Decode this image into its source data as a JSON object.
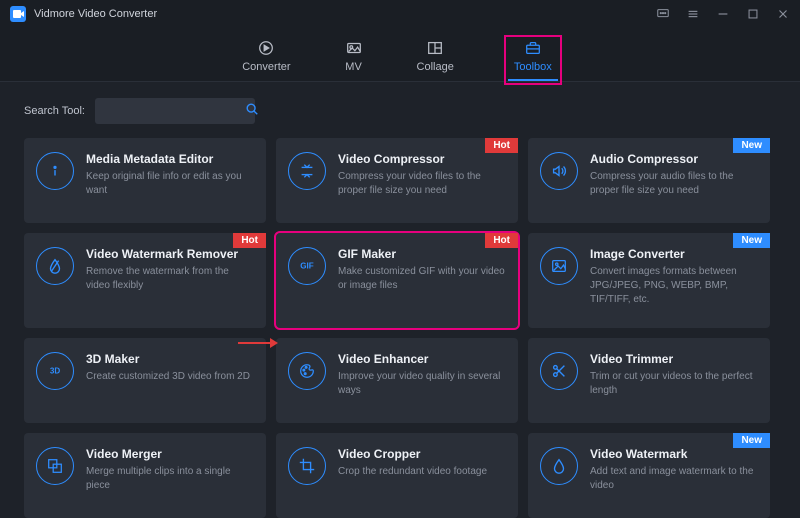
{
  "app": {
    "title": "Vidmore Video Converter"
  },
  "nav": {
    "tabs": [
      {
        "label": "Converter"
      },
      {
        "label": "MV"
      },
      {
        "label": "Collage"
      },
      {
        "label": "Toolbox"
      }
    ]
  },
  "search": {
    "label": "Search Tool:",
    "value": ""
  },
  "badges": {
    "hot": "Hot",
    "new": "New"
  },
  "tools": [
    {
      "icon": "info",
      "title": "Media Metadata Editor",
      "desc": "Keep original file info or edit as you want",
      "badge": ""
    },
    {
      "icon": "compress",
      "title": "Video Compressor",
      "desc": "Compress your video files to the proper file size you need",
      "badge": "hot"
    },
    {
      "icon": "audio-compress",
      "title": "Audio Compressor",
      "desc": "Compress your audio files to the proper file size you need",
      "badge": "new"
    },
    {
      "icon": "droplet",
      "title": "Video Watermark Remover",
      "desc": "Remove the watermark from the video flexibly",
      "badge": "hot"
    },
    {
      "icon": "gif",
      "title": "GIF Maker",
      "desc": "Make customized GIF with your video or image files",
      "badge": "hot"
    },
    {
      "icon": "image",
      "title": "Image Converter",
      "desc": "Convert images formats between JPG/JPEG, PNG, WEBP, BMP, TIF/TIFF, etc.",
      "badge": "new"
    },
    {
      "icon": "3d",
      "title": "3D Maker",
      "desc": "Create customized 3D video from 2D",
      "badge": ""
    },
    {
      "icon": "palette",
      "title": "Video Enhancer",
      "desc": "Improve your video quality in several ways",
      "badge": ""
    },
    {
      "icon": "scissors",
      "title": "Video Trimmer",
      "desc": "Trim or cut your videos to the perfect length",
      "badge": ""
    },
    {
      "icon": "merge",
      "title": "Video Merger",
      "desc": "Merge multiple clips into a single piece",
      "badge": ""
    },
    {
      "icon": "crop",
      "title": "Video Cropper",
      "desc": "Crop the redundant video footage",
      "badge": ""
    },
    {
      "icon": "watermark",
      "title": "Video Watermark",
      "desc": "Add text and image watermark to the video",
      "badge": "new"
    }
  ]
}
